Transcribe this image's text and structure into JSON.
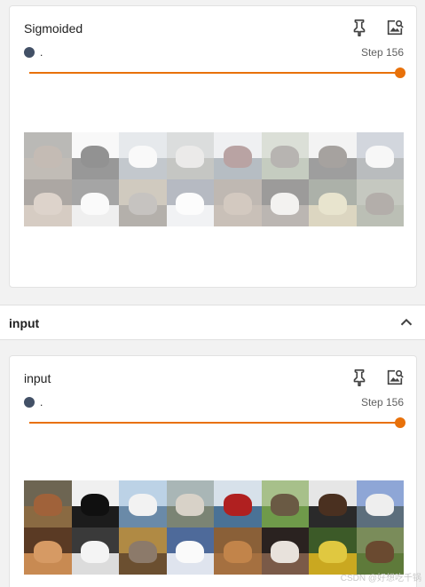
{
  "colors": {
    "accent": "#e8710a",
    "run_dot": "#425066",
    "track_bg": "#e0e0e0"
  },
  "cards": [
    {
      "title": "Sigmoided",
      "run_name": ".",
      "step_label": "Step 156",
      "slider_fraction": 1.0,
      "pin_icon": "pin-icon",
      "image_search_icon": "image-search-icon",
      "image_filter": "dimmed"
    },
    {
      "title": "input",
      "run_name": ".",
      "step_label": "Step 156",
      "slider_fraction": 1.0,
      "pin_icon": "pin-icon",
      "image_search_icon": "image-search-icon",
      "image_filter": "normal"
    }
  ],
  "section": {
    "title": "input",
    "collapse_icon": "chevron-up-icon"
  },
  "image_grid": {
    "tiles": [
      {
        "sky": "#6d6552",
        "ground": "#8a6a42",
        "subject": "#a0623a"
      },
      {
        "sky": "#f0f0f0",
        "ground": "#1c1c1c",
        "subject": "#101010"
      },
      {
        "sky": "#bcd2e6",
        "ground": "#6a8aa8",
        "subject": "#f2f2f2"
      },
      {
        "sky": "#a9b6b6",
        "ground": "#7b8474",
        "subject": "#d8d2c8"
      },
      {
        "sky": "#d7e1ea",
        "ground": "#4a7296",
        "subject": "#b02020"
      },
      {
        "sky": "#a7c08a",
        "ground": "#6f9a4a",
        "subject": "#6a5a44"
      },
      {
        "sky": "#e6e6e6",
        "ground": "#2a2a2a",
        "subject": "#4a3020"
      },
      {
        "sky": "#8ea6d6",
        "ground": "#5c6e7c",
        "subject": "#eeeeee"
      },
      {
        "sky": "#5a3a24",
        "ground": "#c88a52",
        "subject": "#d69a64"
      },
      {
        "sky": "#3a3a3a",
        "ground": "#dcdcdc",
        "subject": "#f4f4f4"
      },
      {
        "sky": "#b08a44",
        "ground": "#6b4f30",
        "subject": "#8c7a6a"
      },
      {
        "sky": "#4e6a9a",
        "ground": "#dfe4ee",
        "subject": "#fafafa"
      },
      {
        "sky": "#8a6038",
        "ground": "#a57040",
        "subject": "#c2844a"
      },
      {
        "sky": "#2a2220",
        "ground": "#7a5a48",
        "subject": "#e8e2dc"
      },
      {
        "sky": "#3c5a28",
        "ground": "#caa820",
        "subject": "#e0c840"
      },
      {
        "sky": "#7a8c5a",
        "ground": "#5e7a3a",
        "subject": "#6a4a30"
      }
    ]
  },
  "watermark": "CSDN @好想吃千锅"
}
